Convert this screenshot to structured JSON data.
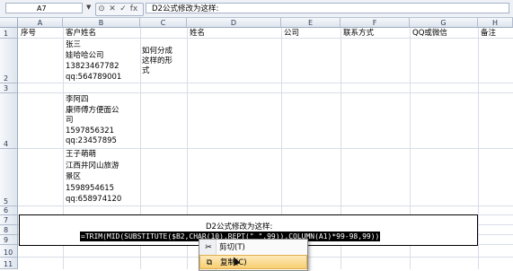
{
  "formula_bar": {
    "name_box": "A7",
    "fx_buttons": [
      "⊙",
      "✕",
      "✓",
      "fx"
    ],
    "content": "D2公式修改为这样:"
  },
  "columns": [
    "A",
    "B",
    "C",
    "D",
    "E",
    "F",
    "G",
    "H"
  ],
  "rows": [
    "1",
    "2",
    "3",
    "4",
    "5",
    "6",
    "7",
    "8",
    "9",
    "10",
    "11"
  ],
  "cells": {
    "a1": "序号",
    "b1": "客户姓名",
    "d1": "姓名",
    "e1": "公司",
    "f1": "联系方式",
    "g1": "QQ或微信",
    "h1": "备注",
    "b2": "张三\n娃哈哈公司\n13823467782\nqq:564789001",
    "c2": "如何分成\n这样的形\n式",
    "b4": "李阿四\n康师傅方便面公\n司\n1597856321\nqq:23457895",
    "b5": "王子萌萌\n江西井冈山旅游\n景区\n1598954615\nqq:658974120"
  },
  "formula_box": {
    "label": "D2公式修改为这样:",
    "formula": "=TRIM(MID(SUBSTITUTE($B2,CHAR(10),REPT(\" \",99)),COLUMN(A1)*99-98,99))"
  },
  "context_menu": {
    "items": [
      {
        "label": "剪切(T)",
        "icon": "scissors-icon",
        "glyph": "✂"
      },
      {
        "label": "复制(C)",
        "icon": "copy-icon",
        "glyph": "⧉"
      }
    ]
  }
}
